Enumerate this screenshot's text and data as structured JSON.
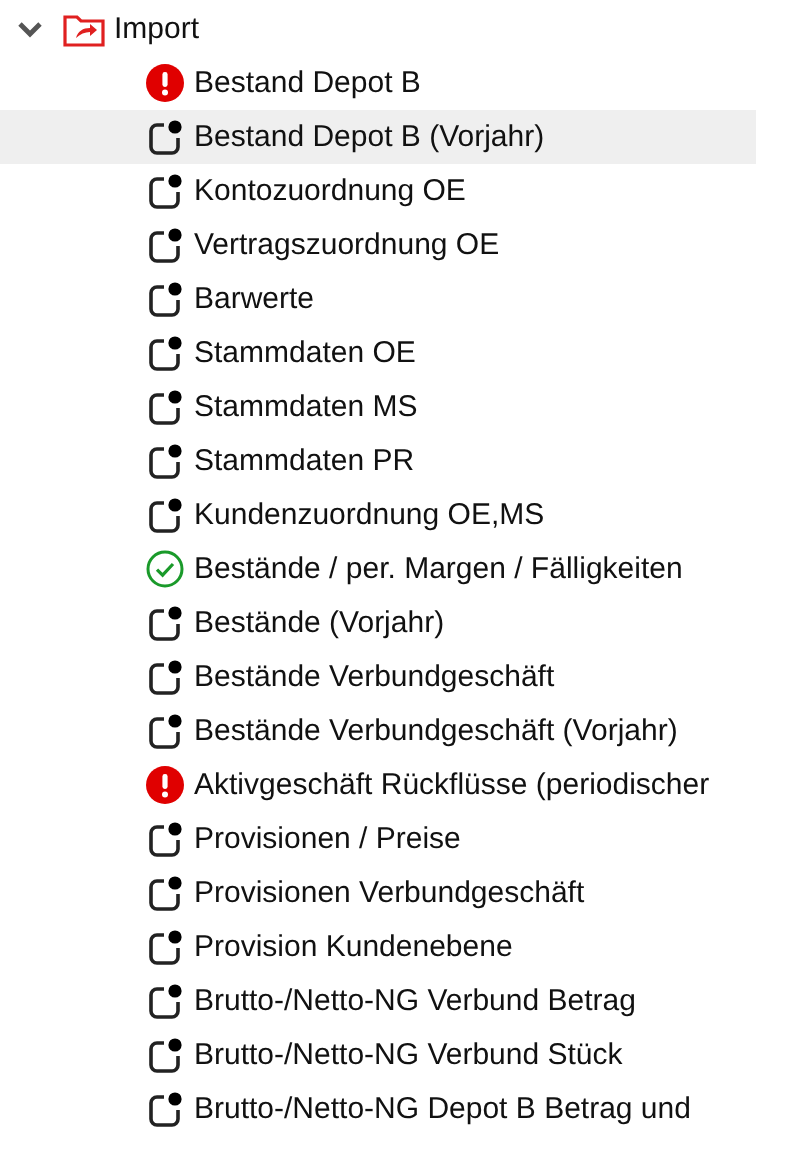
{
  "tree": {
    "label": "Import",
    "expanded": true,
    "children": [
      {
        "label": "Bestand Depot B",
        "kind": "error",
        "selected": false
      },
      {
        "label": "Bestand Depot B (Vorjahr)",
        "kind": "pending",
        "selected": true
      },
      {
        "label": "Kontozuordnung OE",
        "kind": "pending",
        "selected": false
      },
      {
        "label": "Vertragszuordnung OE",
        "kind": "pending",
        "selected": false
      },
      {
        "label": "Barwerte",
        "kind": "pending",
        "selected": false
      },
      {
        "label": "Stammdaten OE",
        "kind": "pending",
        "selected": false
      },
      {
        "label": "Stammdaten MS",
        "kind": "pending",
        "selected": false
      },
      {
        "label": "Stammdaten PR",
        "kind": "pending",
        "selected": false
      },
      {
        "label": "Kundenzuordnung OE,MS",
        "kind": "pending",
        "selected": false
      },
      {
        "label": "Bestände / per. Margen / Fälligkeiten",
        "kind": "done",
        "selected": false
      },
      {
        "label": "Bestände (Vorjahr)",
        "kind": "pending",
        "selected": false
      },
      {
        "label": "Bestände Verbundgeschäft",
        "kind": "pending",
        "selected": false
      },
      {
        "label": "Bestände Verbundgeschäft (Vorjahr)",
        "kind": "pending",
        "selected": false
      },
      {
        "label": "Aktivgeschäft Rückflüsse (periodischer",
        "kind": "error",
        "selected": false
      },
      {
        "label": "Provisionen / Preise",
        "kind": "pending",
        "selected": false
      },
      {
        "label": "Provisionen Verbundgeschäft",
        "kind": "pending",
        "selected": false
      },
      {
        "label": "Provision Kundenebene",
        "kind": "pending",
        "selected": false
      },
      {
        "label": "Brutto-/Netto-NG Verbund Betrag",
        "kind": "pending",
        "selected": false
      },
      {
        "label": "Brutto-/Netto-NG Verbund Stück",
        "kind": "pending",
        "selected": false
      },
      {
        "label": "Brutto-/Netto-NG Depot B Betrag und",
        "kind": "pending",
        "selected": false
      }
    ]
  }
}
